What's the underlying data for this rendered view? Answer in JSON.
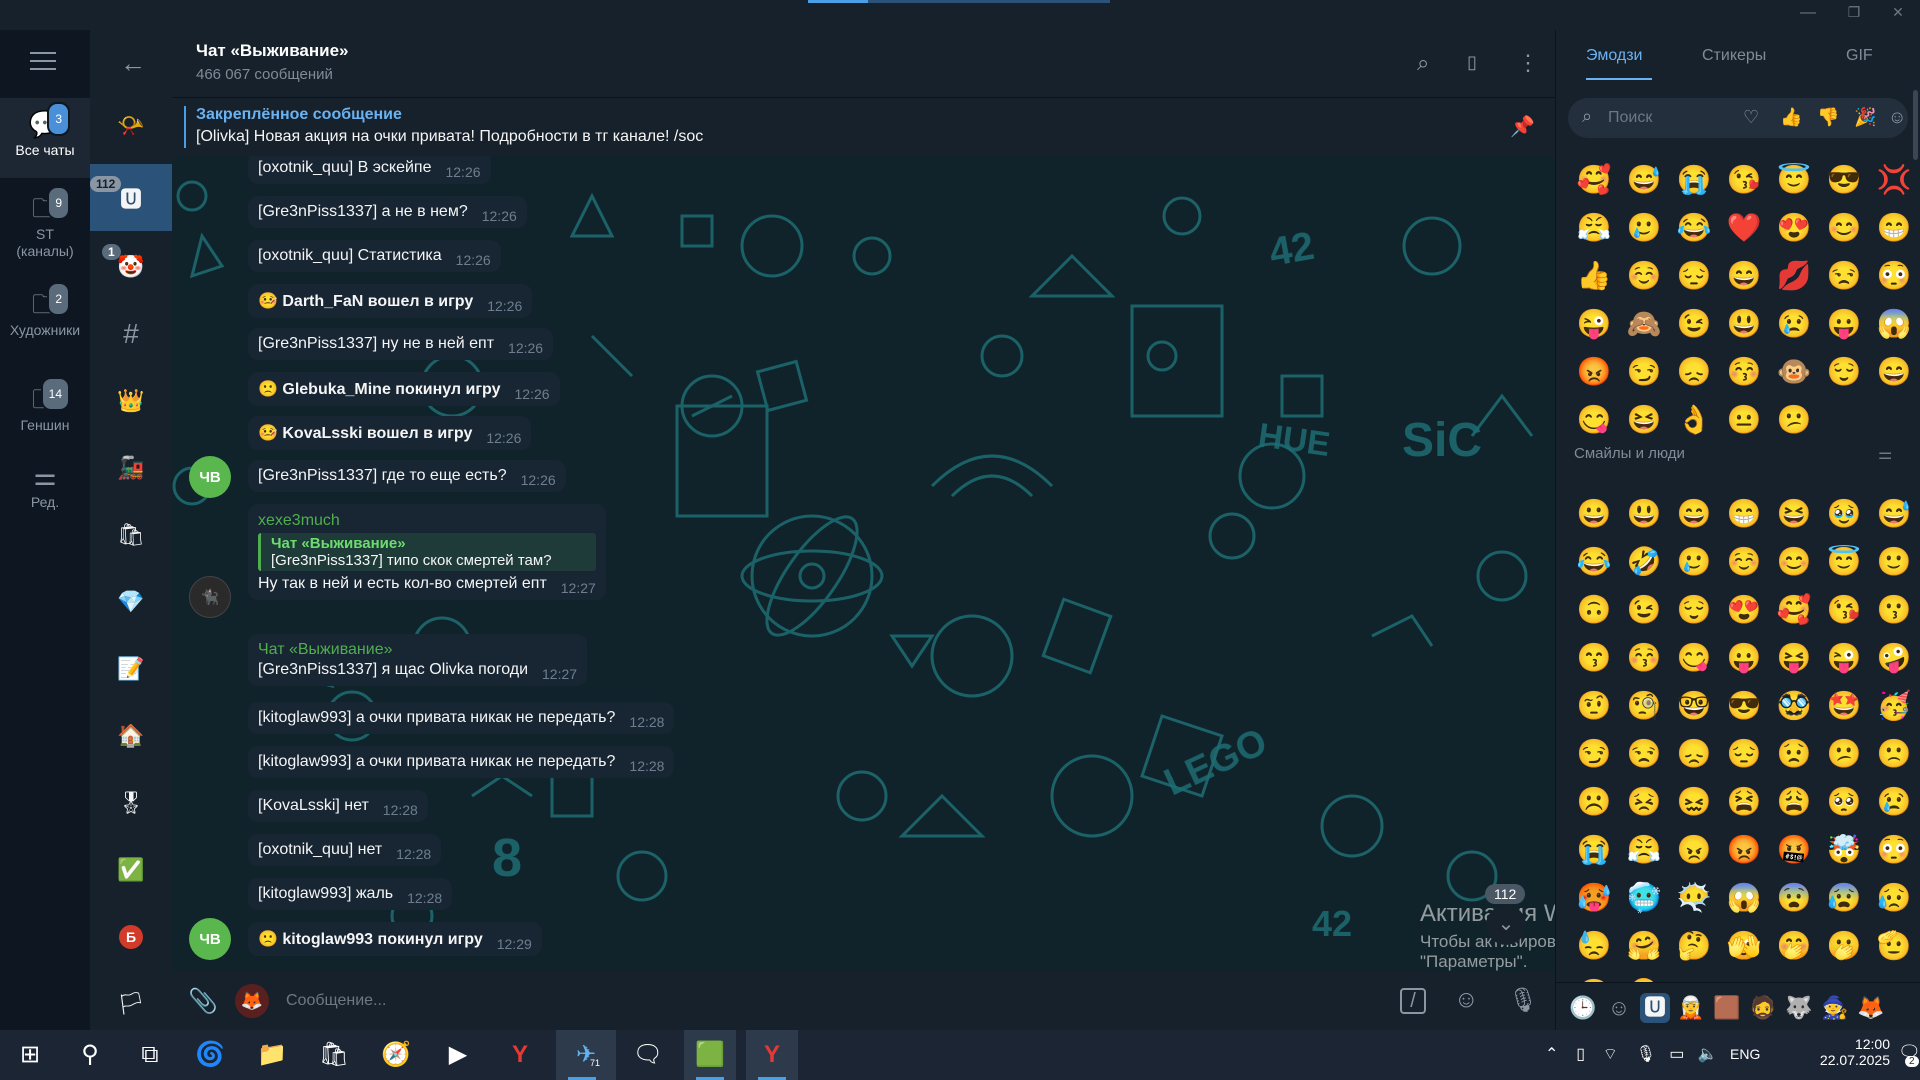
{
  "window": {
    "minimize": "—",
    "maximize": "❐",
    "close": "✕"
  },
  "folders": [
    {
      "label": "Все чаты",
      "badge": "3",
      "icon": "chat-bubbles-icon"
    },
    {
      "label": "ST (каналы)",
      "badge": "9",
      "icon": "folder-icon"
    },
    {
      "label": "Художники",
      "badge": "2",
      "icon": "folder-icon"
    },
    {
      "label": "Геншин",
      "badge": "14",
      "icon": "folder-icon"
    },
    {
      "label": "Ред.",
      "badge": "",
      "icon": "sliders-icon"
    }
  ],
  "chatlist": {
    "badges": {
      "first": "112",
      "second": "1"
    },
    "avatars": [
      "📯",
      "🆄",
      "🤡",
      "#",
      "👑",
      "🚂",
      "🛍",
      "💎",
      "📝",
      "🏠",
      "🎖",
      "✅",
      "Б",
      "🏳"
    ]
  },
  "header": {
    "title": "Чат «Выживание»",
    "subtitle": "466 067 сообщений"
  },
  "pinned": {
    "title": "Закреплённое сообщение",
    "text": "[Olivka] Новая акция на очки привата! Подробности в тг канале! /soc"
  },
  "messages": [
    {
      "text": "[oxotnik_quu] В эскейпе",
      "time": "12:26"
    },
    {
      "text": "[Gre3nPiss1337] а не в нем?",
      "time": "12:26"
    },
    {
      "text": "[oxotnik_quu] Статистика",
      "time": "12:26"
    },
    {
      "emoji": "🤒",
      "text": "Darth_FaN вошел в игру",
      "time": "12:26"
    },
    {
      "text": "[Gre3nPiss1337]  ну не в ней епт",
      "time": "12:26"
    },
    {
      "emoji": "🙁",
      "text": "Glebuka_Mine покинул игру",
      "time": "12:26"
    },
    {
      "emoji": "🤒",
      "text": "KovaLsski вошел в игру",
      "time": "12:26"
    },
    {
      "text": "[Gre3nPiss1337]  где то еще есть?",
      "time": "12:26"
    },
    {
      "sender": "xexe3much",
      "reply_title": "Чат «Выживание»",
      "reply_text": "[Gre3nPiss1337]  типо скок смертей там?",
      "text": "Ну так в ней и есть кол-во смертей епт",
      "time": "12:27"
    },
    {
      "sender": "Чат «Выживание»",
      "text": "[Gre3nPiss1337]  я щас Olivka погоди",
      "time": "12:27"
    },
    {
      "text": "[kitoglaw993]  а очки привата никак не передать?",
      "time": "12:28"
    },
    {
      "text": "[kitoglaw993]  а очки привата никак не передать?",
      "time": "12:28"
    },
    {
      "text": "[KovaLsski] нет",
      "time": "12:28"
    },
    {
      "text": "[oxotnik_quu] нет",
      "time": "12:28"
    },
    {
      "text": "[kitoglaw993]  жаль",
      "time": "12:28"
    },
    {
      "emoji": "🙁",
      "text": "kitoglaw993 покинул игру",
      "time": "12:29"
    }
  ],
  "avatars": {
    "chv": "ЧВ"
  },
  "scroll": {
    "badge": "112"
  },
  "watermark": {
    "line1": "Активация Windows",
    "line2": "Чтобы активировать Windows, перейдите в раздел",
    "line3": "\"Параметры\"."
  },
  "composer": {
    "placeholder": "Сообщение..."
  },
  "emoji_panel": {
    "tabs": [
      "Эмодзи",
      "Стикеры",
      "GIF"
    ],
    "search_placeholder": "Поиск",
    "recent": [
      "🥰",
      "😅",
      "😭",
      "😘",
      "😇",
      "😎",
      "💢",
      "😤",
      "🥲",
      "😂",
      "❤️",
      "😍",
      "😊",
      "😁",
      "👍",
      "☺️",
      "😔",
      "😄",
      "💋",
      "😒",
      "😳",
      "😜",
      "🙈",
      "😉",
      "😃",
      "😢",
      "😛",
      "😱",
      "😡",
      "😏",
      "😞",
      "😚",
      "🐵",
      "😌",
      "😄",
      "😋",
      "😆",
      "👌",
      "😐",
      "😕"
    ],
    "section_title": "Смайлы и люди",
    "people": [
      "😀",
      "😃",
      "😄",
      "😁",
      "😆",
      "🥹",
      "😅",
      "😂",
      "🤣",
      "🥲",
      "☺️",
      "😊",
      "😇",
      "🙂",
      "🙃",
      "😉",
      "😌",
      "😍",
      "🥰",
      "😘",
      "😗",
      "😙",
      "😚",
      "😋",
      "😛",
      "😝",
      "😜",
      "🤪",
      "🤨",
      "🧐",
      "🤓",
      "😎",
      "🥸",
      "🤩",
      "🥳",
      "😏",
      "😒",
      "😞",
      "😔",
      "😟",
      "😕",
      "🙁",
      "☹️",
      "😣",
      "😖",
      "😫",
      "😩",
      "🥺",
      "😢",
      "😭",
      "😤",
      "😠",
      "😡",
      "🤬",
      "🤯",
      "😳",
      "🥵",
      "🥶",
      "😶‍🌫️",
      "😱",
      "😨",
      "😰",
      "😥",
      "😓",
      "🤗",
      "🤔",
      "🫣",
      "🤭",
      "🫢",
      "🫡",
      "🤫",
      "🫠"
    ],
    "sets": [
      "🕒",
      "☺",
      "🆄",
      "🧝",
      "🟫",
      "🧔",
      "🐺",
      "🧙",
      "🦊"
    ]
  },
  "taskbar": {
    "apps": [
      "⊞",
      "⚲",
      "⧉",
      "🌀",
      "📁",
      "🛍",
      "🧭",
      "▶",
      "Y",
      "✈",
      "🗨",
      "🟩",
      "Y"
    ],
    "telegram_badge": "71",
    "lang": "ENG",
    "time": "12:00",
    "date": "22.07.2025",
    "notif_badge": "2"
  },
  "colors": {
    "accent": "#6ab2f2",
    "bubble": "#182533",
    "header": "#17212b",
    "bg": "#0e1621"
  }
}
